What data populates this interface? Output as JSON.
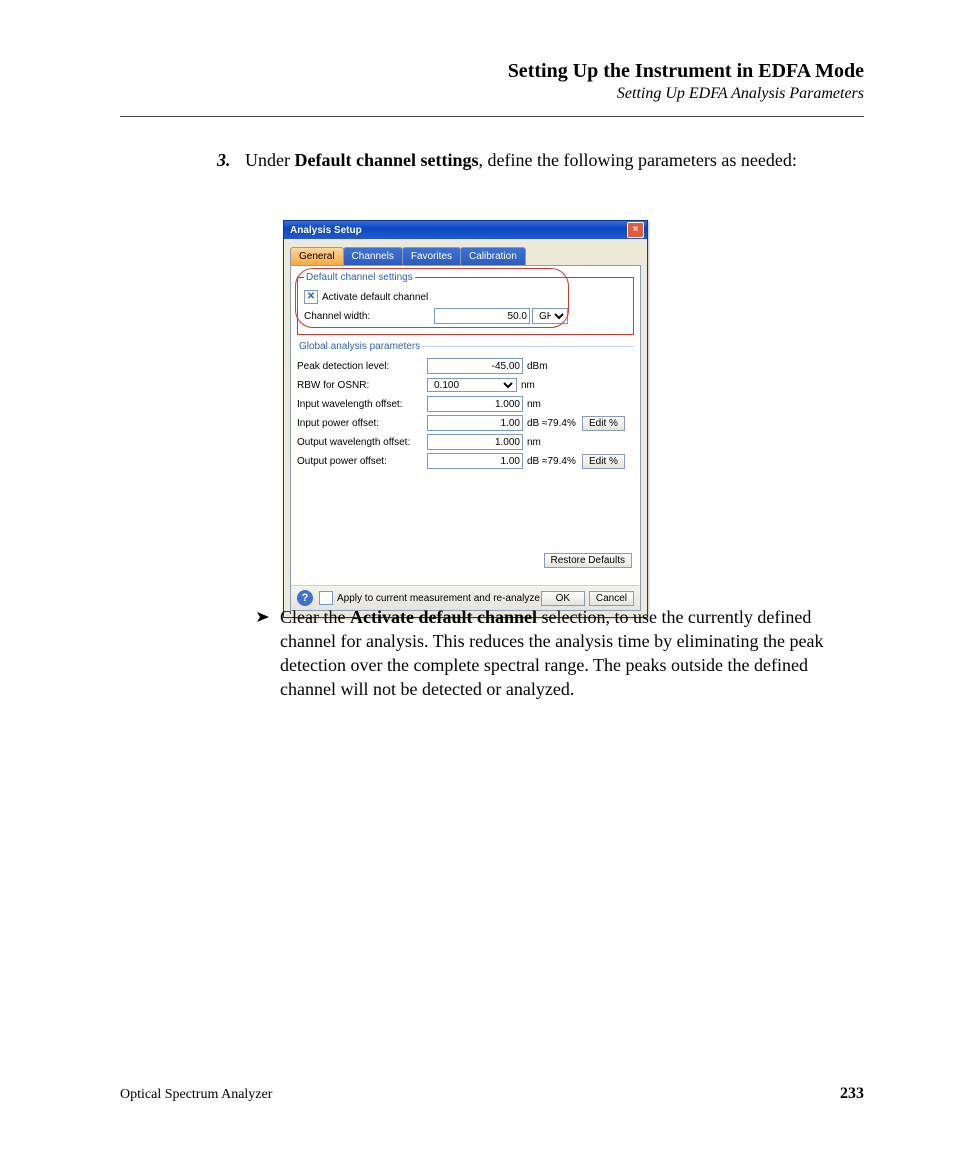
{
  "header": {
    "chapter": "Setting Up the Instrument in EDFA Mode",
    "section": "Setting Up EDFA Analysis Parameters"
  },
  "step": {
    "number": "3.",
    "pre": "Under ",
    "bold": "Default channel settings",
    "post": ", define the following parameters as needed:"
  },
  "bullet": {
    "pre": "Clear the ",
    "bold": "Activate default channel",
    "post": " selection, to use the currently defined channel for analysis. This reduces the analysis time by eliminating the peak detection over the complete spectral range. The peaks outside the defined channel will not be detected or analyzed."
  },
  "dialog": {
    "title": "Analysis Setup",
    "tabs": [
      "General",
      "Channels",
      "Favorites",
      "Calibration"
    ],
    "activeTab": 0,
    "defaultChannel": {
      "legend": "Default channel settings",
      "activateLabel": "Activate default channel",
      "activateChecked": true,
      "widthLabel": "Channel width:",
      "widthValue": "50.0",
      "widthUnit": "GHz"
    },
    "global": {
      "legend": "Global analysis parameters",
      "rows": [
        {
          "label": "Peak detection level:",
          "value": "-45.00",
          "unit": "dBm",
          "select": false,
          "editBtn": false
        },
        {
          "label": "RBW for OSNR:",
          "value": "0.100",
          "unit": "nm",
          "select": true,
          "editBtn": false
        },
        {
          "label": "Input wavelength offset:",
          "value": "1.000",
          "unit": "nm",
          "select": false,
          "editBtn": false
        },
        {
          "label": "Input power offset:",
          "value": "1.00",
          "unit": "dB ≈79.4%",
          "select": false,
          "editBtn": true
        },
        {
          "label": "Output wavelength offset:",
          "value": "1.000",
          "unit": "nm",
          "select": false,
          "editBtn": false
        },
        {
          "label": "Output power offset:",
          "value": "1.00",
          "unit": "dB ≈79.4%",
          "select": false,
          "editBtn": true
        }
      ]
    },
    "editBtn": "Edit %",
    "restore": "Restore Defaults",
    "applyLabel": "Apply to current measurement and re-analyze",
    "ok": "OK",
    "cancel": "Cancel"
  },
  "footer": {
    "left": "Optical Spectrum Analyzer",
    "right": "233"
  }
}
